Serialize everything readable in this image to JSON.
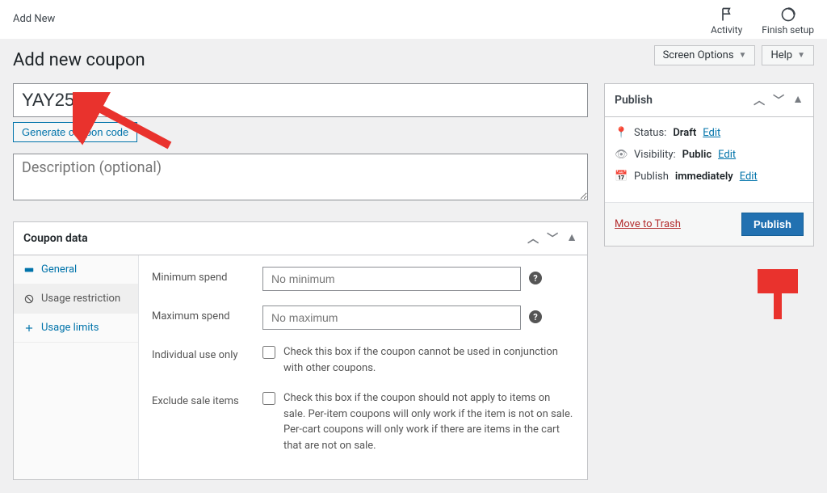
{
  "topbar": {
    "add_new": "Add New",
    "activity": "Activity",
    "finish_setup": "Finish setup"
  },
  "header_buttons": {
    "screen_options": "Screen Options",
    "help": "Help"
  },
  "page_title": "Add new coupon",
  "coupon_code": "YAY25",
  "generate_btn": "Generate coupon code",
  "description_placeholder": "Description (optional)",
  "coupon_panel": {
    "title": "Coupon data",
    "tabs": {
      "general": "General",
      "usage_restriction": "Usage restriction",
      "usage_limits": "Usage limits"
    },
    "fields": {
      "min_spend_label": "Minimum spend",
      "min_spend_placeholder": "No minimum",
      "max_spend_label": "Maximum spend",
      "max_spend_placeholder": "No maximum",
      "individual_label": "Individual use only",
      "individual_help": "Check this box if the coupon cannot be used in conjunction with other coupons.",
      "exclude_sale_label": "Exclude sale items",
      "exclude_sale_help": "Check this box if the coupon should not apply to items on sale. Per-item coupons will only work if the item is not on sale. Per-cart coupons will only work if there are items in the cart that are not on sale."
    }
  },
  "publish": {
    "title": "Publish",
    "status_label": "Status:",
    "status_value": "Draft",
    "visibility_label": "Visibility:",
    "visibility_value": "Public",
    "publish_label": "Publish",
    "publish_value": "immediately",
    "edit": "Edit",
    "trash": "Move to Trash",
    "button": "Publish"
  }
}
